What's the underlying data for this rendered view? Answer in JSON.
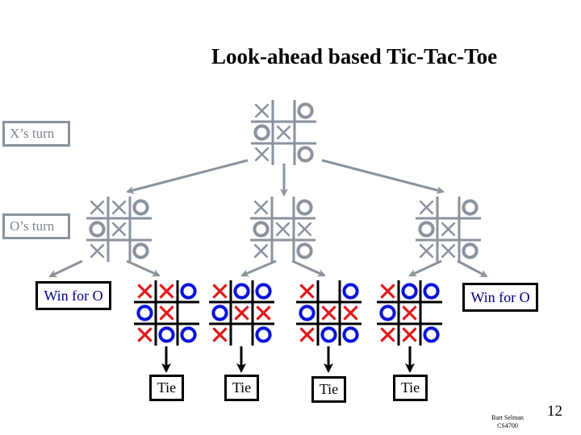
{
  "title": "Look-ahead based Tic-Tac-Toe",
  "labels": {
    "x_turn": "X’s turn",
    "o_turn": "O’s turn",
    "win_left": "Win for O",
    "win_right": "Win for O"
  },
  "colors": {
    "gray_mark": "#8a929e",
    "x_red": "#e01a1a",
    "o_blue": "#0a14d8",
    "grid_black": "#000000",
    "win_text": "#000080"
  },
  "tree": {
    "root": {
      "level": "X's turn",
      "board": [
        [
          "X",
          "",
          "O"
        ],
        [
          "O",
          "X",
          ""
        ],
        [
          "X",
          "",
          "O"
        ]
      ]
    },
    "children": [
      {
        "level": "O's turn",
        "board": [
          [
            "X",
            "X",
            "O"
          ],
          [
            "O",
            "X",
            ""
          ],
          [
            "X",
            "",
            "O"
          ]
        ],
        "outcome": "Win for O",
        "grandchildren": [
          {
            "board": [
              [
                "X",
                "X",
                "O"
              ],
              [
                "O",
                "X",
                ""
              ],
              [
                "X",
                "O",
                "O"
              ]
            ],
            "outcome": "Tie"
          }
        ]
      },
      {
        "level": "O's turn",
        "board": [
          [
            "X",
            "",
            "O"
          ],
          [
            "O",
            "X",
            "X"
          ],
          [
            "X",
            "",
            "O"
          ]
        ],
        "grandchildren": [
          {
            "board": [
              [
                "X",
                "O",
                "O"
              ],
              [
                "O",
                "X",
                "X"
              ],
              [
                "X",
                "",
                "O"
              ]
            ],
            "outcome": "Tie"
          },
          {
            "board": [
              [
                "X",
                "",
                "O"
              ],
              [
                "O",
                "X",
                "X"
              ],
              [
                "X",
                "O",
                "O"
              ]
            ],
            "outcome": "Tie"
          }
        ]
      },
      {
        "level": "O's turn",
        "board": [
          [
            "X",
            "",
            "O"
          ],
          [
            "O",
            "X",
            ""
          ],
          [
            "X",
            "X",
            "O"
          ]
        ],
        "outcome": "Win for O",
        "grandchildren": [
          {
            "board": [
              [
                "X",
                "O",
                "O"
              ],
              [
                "O",
                "X",
                ""
              ],
              [
                "X",
                "X",
                "O"
              ]
            ],
            "outcome": "Tie"
          }
        ]
      }
    ]
  },
  "outcomes": [
    "Tie",
    "Tie",
    "Tie",
    "Tie"
  ],
  "footer": {
    "author": "Bart Selman",
    "course": "CS4700",
    "page_number": "12"
  }
}
